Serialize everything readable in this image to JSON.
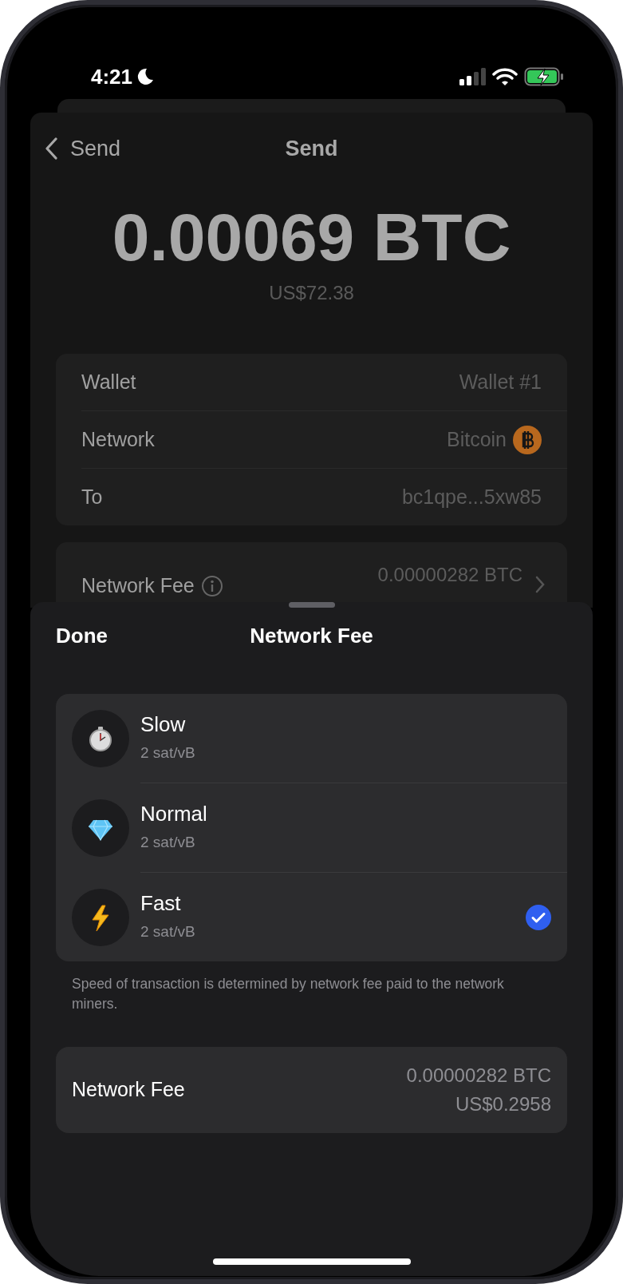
{
  "status_bar": {
    "time": "4:21"
  },
  "back_screen": {
    "back_label": "Send",
    "title": "Send",
    "amount": "0.00069 BTC",
    "amount_fiat": "US$72.38",
    "details": [
      {
        "label": "Wallet",
        "value": "Wallet #1",
        "kind": "text"
      },
      {
        "label": "Network",
        "value": "Bitcoin",
        "kind": "coin"
      },
      {
        "label": "To",
        "value": "bc1qpe...5xw85",
        "kind": "text"
      }
    ],
    "fee_row": {
      "label": "Network Fee",
      "value": "0.00000282 BTC"
    }
  },
  "sheet": {
    "done": "Done",
    "title": "Network Fee",
    "options": [
      {
        "name": "Slow",
        "rate": "2 sat/vB",
        "kind": "stopwatch",
        "selected": false
      },
      {
        "name": "Normal",
        "rate": "2 sat/vB",
        "kind": "diamond",
        "selected": false
      },
      {
        "name": "Fast",
        "rate": "2 sat/vB",
        "kind": "bolt",
        "selected": true
      }
    ],
    "note": "Speed of transaction is determined by network fee paid to the network miners.",
    "fee": {
      "label": "Network Fee",
      "btc": "0.00000282 BTC",
      "fiat": "US$0.2958"
    }
  }
}
